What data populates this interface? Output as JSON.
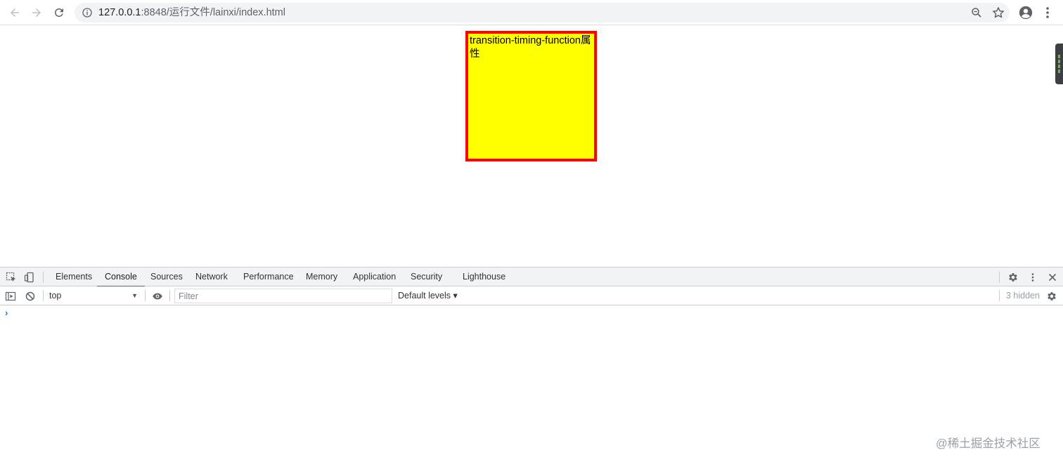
{
  "browser": {
    "url_host": "127.0.0.1",
    "url_rest": ":8848/运行文件/lainxi/index.html",
    "back_icon": "arrow-left-icon",
    "forward_icon": "arrow-right-icon",
    "reload_icon": "reload-icon"
  },
  "page": {
    "box_text": "transition-timing-function属性",
    "box_background": "#ffff00",
    "box_border_color": "#ff0000"
  },
  "devtools": {
    "tabs": [
      {
        "label": "Elements"
      },
      {
        "label": "Console",
        "active": true
      },
      {
        "label": "Sources"
      },
      {
        "label": "Network"
      },
      {
        "label": "Performance"
      },
      {
        "label": "Memory"
      },
      {
        "label": "Application"
      },
      {
        "label": "Security"
      },
      {
        "label": "Lighthouse"
      }
    ],
    "console": {
      "context": "top",
      "filter_placeholder": "Filter",
      "levels": "Default levels ▾",
      "hidden": "3 hidden",
      "prompt": "›"
    },
    "accent": "#1a73e8"
  },
  "watermark": "@稀土掘金技术社区"
}
